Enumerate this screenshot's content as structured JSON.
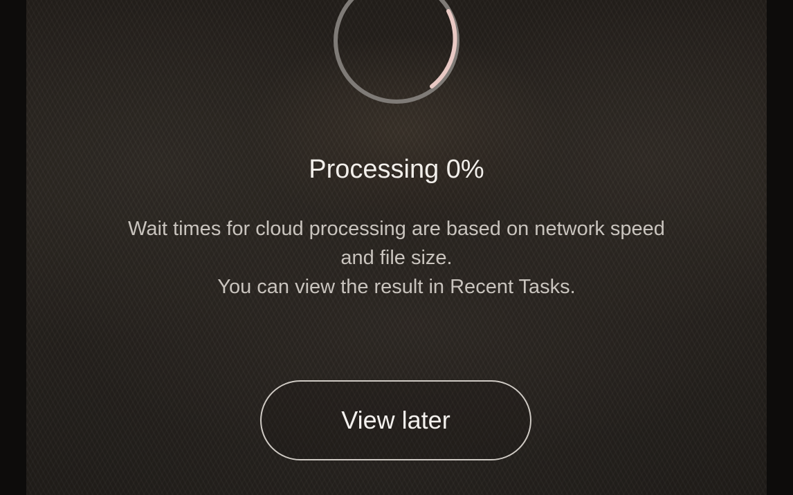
{
  "processing": {
    "title": "Processing 0%",
    "progress_percent": 0,
    "description_lines": [
      "Wait times for cloud processing are based on network speed",
      "and file size.",
      "You can view the result in Recent Tasks."
    ]
  },
  "actions": {
    "view_later_label": "View later"
  },
  "colors": {
    "spinner_track": "#7f7b77",
    "spinner_accent": "#e9c9c4",
    "button_border": "#cfcac4"
  }
}
